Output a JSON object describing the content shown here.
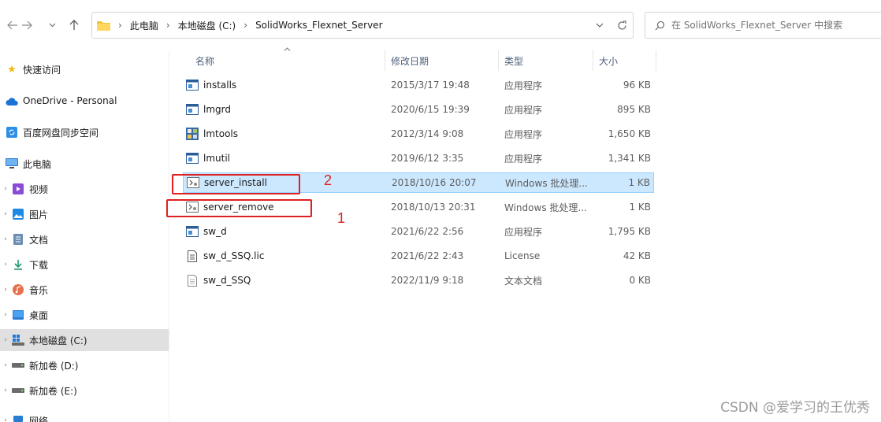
{
  "address": {
    "crumbs": [
      "此电脑",
      "本地磁盘 (C:)",
      "SolidWorks_Flexnet_Server"
    ]
  },
  "search": {
    "placeholder": "在 SolidWorks_Flexnet_Server 中搜索"
  },
  "sidebar": {
    "items": [
      {
        "label": "快速访问",
        "icon": "star-icon"
      },
      {
        "label": "OneDrive - Personal",
        "icon": "cloud-icon"
      },
      {
        "label": "百度网盘同步空间",
        "icon": "sync-folder-icon"
      },
      {
        "label": "此电脑",
        "icon": "computer-icon"
      },
      {
        "label": "视频",
        "icon": "video-icon"
      },
      {
        "label": "图片",
        "icon": "pictures-icon"
      },
      {
        "label": "文档",
        "icon": "documents-icon"
      },
      {
        "label": "下载",
        "icon": "download-icon"
      },
      {
        "label": "音乐",
        "icon": "music-icon"
      },
      {
        "label": "桌面",
        "icon": "desktop-icon"
      },
      {
        "label": "本地磁盘 (C:)",
        "icon": "drive-icon"
      },
      {
        "label": "新加卷 (D:)",
        "icon": "drive-icon"
      },
      {
        "label": "新加卷 (E:)",
        "icon": "drive-icon"
      },
      {
        "label": "网络",
        "icon": "network-icon"
      }
    ]
  },
  "columns": {
    "name": "名称",
    "date": "修改日期",
    "type": "类型",
    "size": "大小"
  },
  "files": [
    {
      "name": "installs",
      "date": "2015/3/17 19:48",
      "type": "应用程序",
      "size": "96 KB",
      "icon": "app-icon"
    },
    {
      "name": "lmgrd",
      "date": "2020/6/15 19:39",
      "type": "应用程序",
      "size": "895 KB",
      "icon": "app-icon"
    },
    {
      "name": "lmtools",
      "date": "2012/3/14 9:08",
      "type": "应用程序",
      "size": "1,650 KB",
      "icon": "lmtools-icon"
    },
    {
      "name": "lmutil",
      "date": "2019/6/12 3:35",
      "type": "应用程序",
      "size": "1,341 KB",
      "icon": "app-icon"
    },
    {
      "name": "server_install",
      "date": "2018/10/16 20:07",
      "type": "Windows 批处理...",
      "size": "1 KB",
      "icon": "batch-icon"
    },
    {
      "name": "server_remove",
      "date": "2018/10/13 20:31",
      "type": "Windows 批处理...",
      "size": "1 KB",
      "icon": "batch-icon"
    },
    {
      "name": "sw_d",
      "date": "2021/6/22 2:56",
      "type": "应用程序",
      "size": "1,795 KB",
      "icon": "app-icon"
    },
    {
      "name": "sw_d_SSQ.lic",
      "date": "2021/6/22 2:43",
      "type": "License",
      "size": "42 KB",
      "icon": "license-icon"
    },
    {
      "name": "sw_d_SSQ",
      "date": "2022/11/9 9:18",
      "type": "文本文档",
      "size": "0 KB",
      "icon": "text-file-icon"
    }
  ],
  "annotations": {
    "step1": "1",
    "step2": "2"
  },
  "watermark": "CSDN @爱学习的王优秀"
}
